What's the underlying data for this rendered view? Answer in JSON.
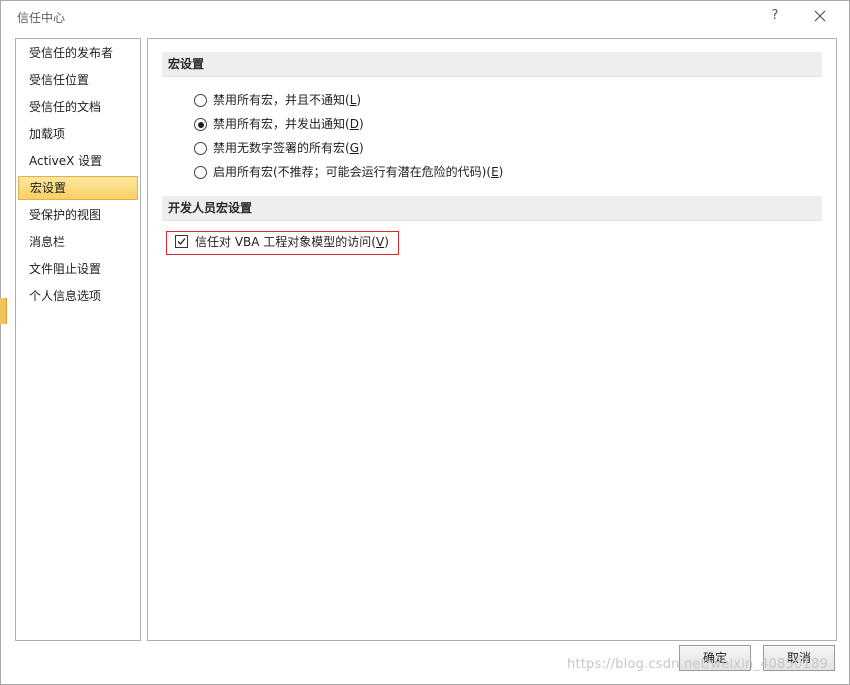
{
  "window": {
    "title": "信任中心",
    "help_label": "?"
  },
  "sidebar": {
    "items": [
      {
        "label": "受信任的发布者",
        "active": false
      },
      {
        "label": "受信任位置",
        "active": false
      },
      {
        "label": "受信任的文档",
        "active": false
      },
      {
        "label": "加载项",
        "active": false
      },
      {
        "label": "ActiveX 设置",
        "active": false
      },
      {
        "label": "宏设置",
        "active": true
      },
      {
        "label": "受保护的视图",
        "active": false
      },
      {
        "label": "消息栏",
        "active": false
      },
      {
        "label": "文件阻止设置",
        "active": false
      },
      {
        "label": "个人信息选项",
        "active": false
      }
    ]
  },
  "macro_settings": {
    "heading": "宏设置",
    "options": [
      {
        "text": "禁用所有宏，并且不通知(",
        "key": "L",
        "suffix": ")",
        "selected": false
      },
      {
        "text": "禁用所有宏，并发出通知(",
        "key": "D",
        "suffix": ")",
        "selected": true
      },
      {
        "text": "禁用无数字签署的所有宏(",
        "key": "G",
        "suffix": ")",
        "selected": false
      },
      {
        "text": "启用所有宏(不推荐；可能会运行有潜在危险的代码)(",
        "key": "E",
        "suffix": ")",
        "selected": false
      }
    ]
  },
  "developer_settings": {
    "heading": "开发人员宏设置",
    "trust_vba": {
      "text": "信任对 VBA 工程对象模型的访问(",
      "key": "V",
      "suffix": ")",
      "checked": true
    }
  },
  "buttons": {
    "ok": "确定",
    "cancel": "取消"
  },
  "watermark": "https://blog.csdn.net/weixin_40850189",
  "colors": {
    "active_item": "#f8cf63",
    "highlight_border": "#e0262b"
  }
}
